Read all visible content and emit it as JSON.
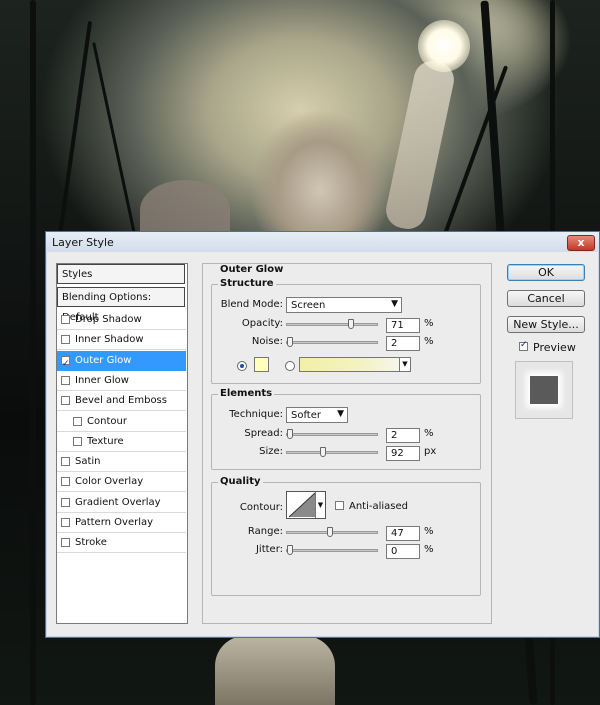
{
  "window": {
    "title": "Layer Style",
    "close_label": "x"
  },
  "styles_list": {
    "header": "Styles",
    "blending": "Blending Options: Default",
    "items": [
      {
        "label": "Drop Shadow",
        "checked": false,
        "selected": false
      },
      {
        "label": "Inner Shadow",
        "checked": false,
        "selected": false
      },
      {
        "label": "Outer Glow",
        "checked": true,
        "selected": true
      },
      {
        "label": "Inner Glow",
        "checked": false,
        "selected": false
      },
      {
        "label": "Bevel and Emboss",
        "checked": false,
        "selected": false
      },
      {
        "label": "Contour",
        "checked": false,
        "selected": false
      },
      {
        "label": "Texture",
        "checked": false,
        "selected": false
      },
      {
        "label": "Satin",
        "checked": false,
        "selected": false
      },
      {
        "label": "Color Overlay",
        "checked": false,
        "selected": false
      },
      {
        "label": "Gradient Overlay",
        "checked": false,
        "selected": false
      },
      {
        "label": "Pattern Overlay",
        "checked": false,
        "selected": false
      },
      {
        "label": "Stroke",
        "checked": false,
        "selected": false
      }
    ]
  },
  "outer_glow": {
    "title": "Outer Glow",
    "structure": {
      "title": "Structure",
      "blend_mode_label": "Blend Mode:",
      "blend_mode_value": "Screen",
      "opacity_label": "Opacity:",
      "opacity_value": "71",
      "opacity_unit": "%",
      "noise_label": "Noise:",
      "noise_value": "2",
      "noise_unit": "%",
      "color": "#ffffbe"
    },
    "elements": {
      "title": "Elements",
      "technique_label": "Technique:",
      "technique_value": "Softer",
      "spread_label": "Spread:",
      "spread_value": "2",
      "spread_unit": "%",
      "size_label": "Size:",
      "size_value": "92",
      "size_unit": "px"
    },
    "quality": {
      "title": "Quality",
      "contour_label": "Contour:",
      "anti_aliased_label": "Anti-aliased",
      "anti_aliased_checked": false,
      "range_label": "Range:",
      "range_value": "47",
      "range_unit": "%",
      "jitter_label": "Jitter:",
      "jitter_value": "0",
      "jitter_unit": "%"
    }
  },
  "buttons": {
    "ok": "OK",
    "cancel": "Cancel",
    "new_style": "New Style...",
    "preview_label": "Preview",
    "preview_checked": true
  }
}
